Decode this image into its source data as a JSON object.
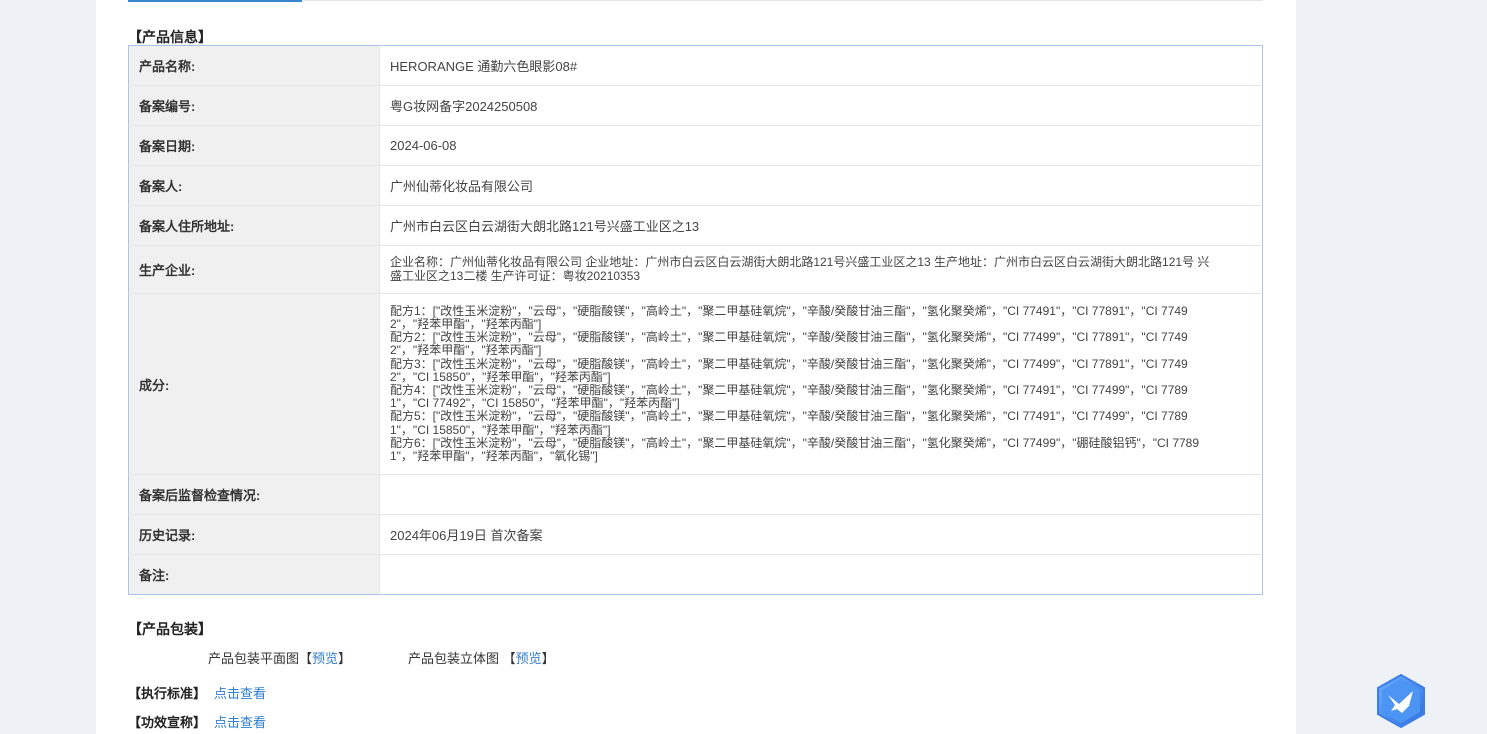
{
  "product_info": {
    "section_title": "【产品信息】",
    "rows": {
      "product_name": {
        "label": "产品名称:",
        "value": "HERORANGE 通勤六色眼影08#"
      },
      "filing_no": {
        "label": "备案编号:",
        "value": "粤G妆网备字2024250508"
      },
      "filing_date": {
        "label": "备案日期:",
        "value": "2024-06-08"
      },
      "filer": {
        "label": "备案人:",
        "value": "广州仙蒂化妆品有限公司"
      },
      "filer_address": {
        "label": "备案人住所地址:",
        "value": "广州市白云区白云湖街大朗北路121号兴盛工业区之13"
      },
      "manufacturer": {
        "label": "生产企业:",
        "value": "企业名称：广州仙蒂化妆品有限公司 企业地址：广州市白云区白云湖街大朗北路121号兴盛工业区之13 生产地址：广州市白云区白云湖街大朗北路121号 兴盛工业区之13二楼 生产许可证：粤妆20210353"
      },
      "ingredients": {
        "label": "成分:",
        "formulas": [
          "配方1：[\"改性玉米淀粉\"，\"云母\"，\"硬脂酸镁\"，\"高岭土\"，\"聚二甲基硅氧烷\"，\"辛酸/癸酸甘油三酯\"，\"氢化聚癸烯\"，\"CI 77491\"，\"CI 77891\"，\"CI 77492\"，\"羟苯甲酯\"，\"羟苯丙酯\"]",
          "配方2：[\"改性玉米淀粉\"，\"云母\"，\"硬脂酸镁\"，\"高岭土\"，\"聚二甲基硅氧烷\"，\"辛酸/癸酸甘油三酯\"，\"氢化聚癸烯\"，\"CI 77499\"，\"CI 77891\"，\"CI 77492\"，\"羟苯甲酯\"，\"羟苯丙酯\"]",
          "配方3：[\"改性玉米淀粉\"，\"云母\"，\"硬脂酸镁\"，\"高岭土\"，\"聚二甲基硅氧烷\"，\"辛酸/癸酸甘油三酯\"，\"氢化聚癸烯\"，\"CI 77499\"，\"CI 77891\"，\"CI 77492\"，\"CI 15850\"，\"羟苯甲酯\"，\"羟苯丙酯\"]",
          "配方4：[\"改性玉米淀粉\"，\"云母\"，\"硬脂酸镁\"，\"高岭土\"，\"聚二甲基硅氧烷\"，\"辛酸/癸酸甘油三酯\"，\"氢化聚癸烯\"，\"CI 77491\"，\"CI 77499\"，\"CI 77891\"，\"CI 77492\"，\"CI 15850\"，\"羟苯甲酯\"，\"羟苯丙酯\"]",
          "配方5：[\"改性玉米淀粉\"，\"云母\"，\"硬脂酸镁\"，\"高岭土\"，\"聚二甲基硅氧烷\"，\"辛酸/癸酸甘油三酯\"，\"氢化聚癸烯\"，\"CI 77491\"，\"CI 77499\"，\"CI 77891\"，\"CI 15850\"，\"羟苯甲酯\"，\"羟苯丙酯\"]",
          "配方6：[\"改性玉米淀粉\"，\"云母\"，\"硬脂酸镁\"，\"高岭土\"，\"聚二甲基硅氧烷\"，\"辛酸/癸酸甘油三酯\"，\"氢化聚癸烯\"，\"CI 77499\"，\"硼硅酸铝钙\"，\"CI 77891\"，\"羟苯甲酯\"，\"羟苯丙酯\"，\"氧化锡\"]"
        ]
      },
      "post_supervision": {
        "label": "备案后监督检查情况:",
        "value": ""
      },
      "history": {
        "label": "历史记录:",
        "value": "2024年06月19日 首次备案"
      },
      "remarks": {
        "label": "备注:",
        "value": ""
      }
    }
  },
  "packaging": {
    "section_title": "【产品包装】",
    "flat_label": "产品包装平面图",
    "flat_open": "【",
    "flat_link": "预览",
    "flat_close": "】",
    "stereo_label": "产品包装立体图",
    "stereo_open": "【",
    "stereo_link": "预览",
    "stereo_close": "】"
  },
  "standard": {
    "label": "【执行标准】",
    "link": "点击查看"
  },
  "efficacy": {
    "label": "【功效宣称】",
    "link": "点击查看"
  },
  "colors": {
    "accent": "#2f7ecf",
    "table_border": "#a9c3e5",
    "label_bg": "#f0f0f0",
    "page_bg": "#eef2f6"
  },
  "floating_button": {
    "icon": "bird-icon"
  }
}
